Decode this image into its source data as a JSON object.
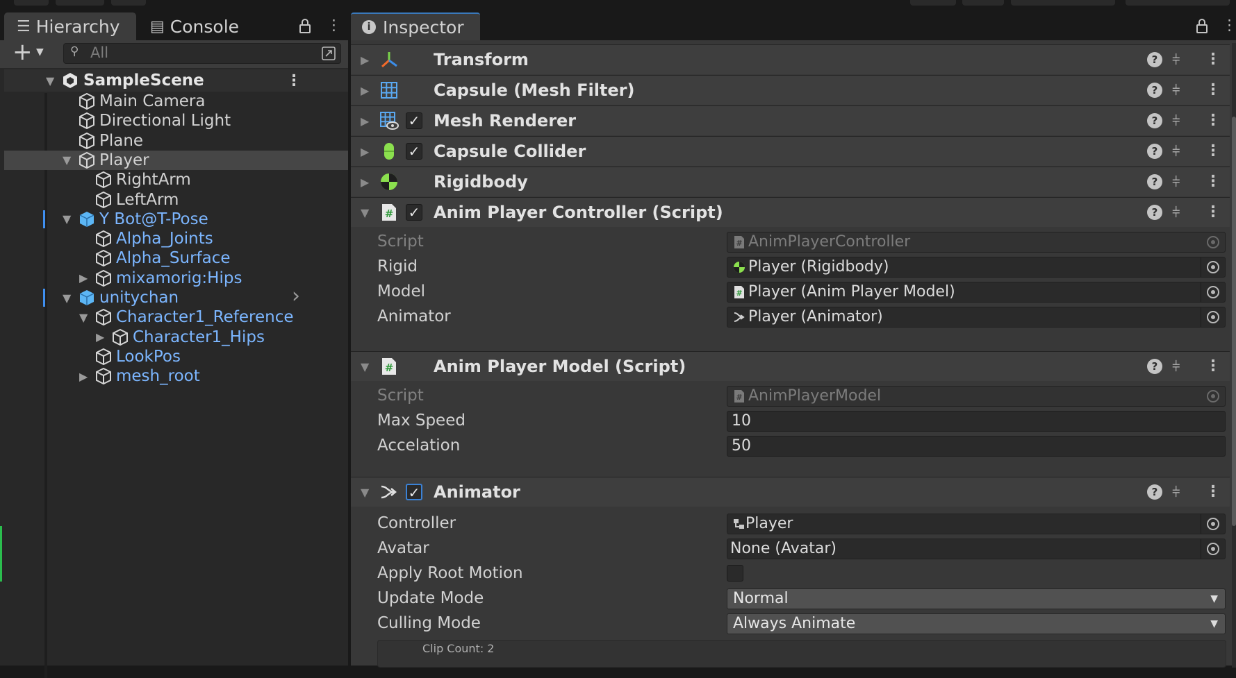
{
  "hierarchy": {
    "tab_label": "Hierarchy",
    "console_label": "Console",
    "add_label": "+",
    "search_placeholder": "All",
    "scene_name": "SampleScene",
    "items": [
      {
        "label": "Main Camera",
        "prefab": false
      },
      {
        "label": "Directional Light",
        "prefab": false
      },
      {
        "label": "Plane",
        "prefab": false
      },
      {
        "label": "Player",
        "prefab": false,
        "selected": true,
        "expanded": true
      },
      {
        "label": "RightArm",
        "prefab": false
      },
      {
        "label": "LeftArm",
        "prefab": false
      },
      {
        "label": "Y Bot@T-Pose",
        "prefab": true,
        "expanded": true
      },
      {
        "label": "Alpha_Joints",
        "prefab": true
      },
      {
        "label": "Alpha_Surface",
        "prefab": true
      },
      {
        "label": "mixamorig:Hips",
        "prefab": true,
        "expanded": false
      },
      {
        "label": "unitychan",
        "prefab": true,
        "expanded": true
      },
      {
        "label": "Character1_Reference",
        "prefab": true,
        "expanded": true
      },
      {
        "label": "Character1_Hips",
        "prefab": true,
        "expanded": false
      },
      {
        "label": "LookPos",
        "prefab": true
      },
      {
        "label": "mesh_root",
        "prefab": true,
        "expanded": false
      }
    ]
  },
  "inspector": {
    "tab_label": "Inspector",
    "components": {
      "transform": "Transform",
      "mesh_filter": "Capsule (Mesh Filter)",
      "mesh_renderer": "Mesh Renderer",
      "capsule_collider": "Capsule Collider",
      "rigidbody": "Rigidbody",
      "anim_controller": "Anim Player Controller (Script)",
      "anim_model": "Anim Player Model (Script)",
      "animator": "Animator"
    },
    "anim_controller_props": {
      "script_label": "Script",
      "script_value": "AnimPlayerController",
      "rigid_label": "Rigid",
      "rigid_value": "Player (Rigidbody)",
      "model_label": "Model",
      "model_value": "Player (Anim Player Model)",
      "animator_label": "Animator",
      "animator_value": "Player (Animator)"
    },
    "anim_model_props": {
      "script_label": "Script",
      "script_value": "AnimPlayerModel",
      "max_speed_label": "Max Speed",
      "max_speed_value": "10",
      "accel_label": "Accelation",
      "accel_value": "50"
    },
    "animator_props": {
      "controller_label": "Controller",
      "controller_value": "Player",
      "avatar_label": "Avatar",
      "avatar_value": "None (Avatar)",
      "root_motion_label": "Apply Root Motion",
      "root_motion_checked": false,
      "update_mode_label": "Update Mode",
      "update_mode_value": "Normal",
      "culling_mode_label": "Culling Mode",
      "culling_mode_value": "Always Animate",
      "clip_count_text": "Clip Count: 2"
    },
    "help_glyph": "?",
    "colors": {
      "accent_blue": "#7cb6ff",
      "check_blue": "#3b82d6",
      "script_green": "#5fd06a"
    }
  }
}
